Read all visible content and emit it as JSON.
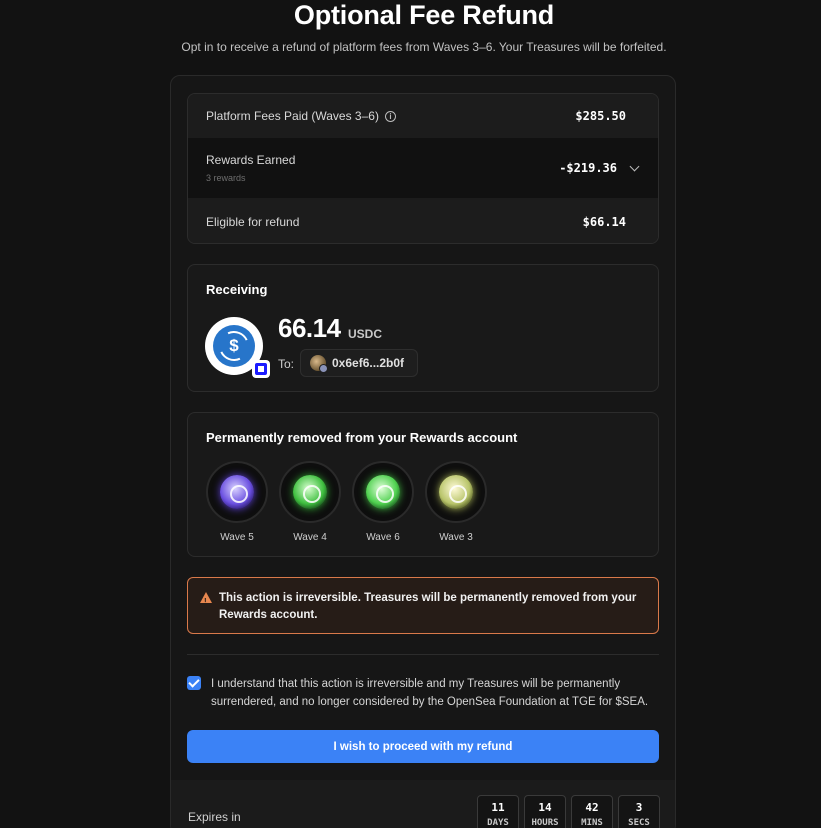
{
  "header": {
    "title": "Optional Fee Refund",
    "subtitle": "Opt in to receive a refund of platform fees from Waves 3–6. Your Treasures will be forfeited."
  },
  "fees": {
    "platform_fees_label": "Platform Fees Paid (Waves 3–6)",
    "platform_fees_value": "$285.50",
    "rewards_label": "Rewards Earned",
    "rewards_sublabel": "3 rewards",
    "rewards_value": "-$219.36",
    "eligible_label": "Eligible for refund",
    "eligible_value": "$66.14"
  },
  "receiving": {
    "title": "Receiving",
    "amount": "66.14",
    "unit": "USDC",
    "token_icon": "usdc-icon",
    "to_label": "To:",
    "address": "0x6ef6...2b0f"
  },
  "removed": {
    "title": "Permanently removed from your Rewards account",
    "items": [
      {
        "label": "Wave 5"
      },
      {
        "label": "Wave 4"
      },
      {
        "label": "Wave 6"
      },
      {
        "label": "Wave 3"
      }
    ]
  },
  "warning": {
    "text": "This action is irreversible. Treasures will be permanently removed from your Rewards account."
  },
  "consent": {
    "checked": true,
    "text": "I understand that this action is irreversible and my Treasures will be permanently surrendered, and no longer considered by the OpenSea Foundation at TGE for $SEA."
  },
  "proceed_label": "I wish to proceed with my refund",
  "expires": {
    "label": "Expires in",
    "timer": [
      {
        "value": "11",
        "unit": "DAYS"
      },
      {
        "value": "14",
        "unit": "HOURS"
      },
      {
        "value": "42",
        "unit": "MINS"
      },
      {
        "value": "3",
        "unit": "SECS"
      }
    ]
  },
  "colors": {
    "accent": "#3b82f6",
    "warning_border": "#d9794a",
    "usdc": "#2775ca"
  }
}
